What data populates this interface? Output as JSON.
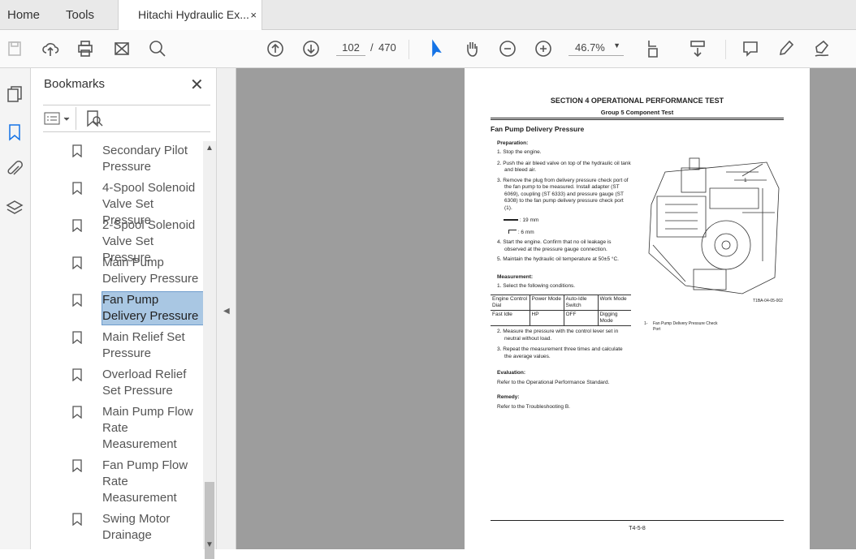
{
  "tabs": {
    "home": "Home",
    "tools": "Tools",
    "document": "Hitachi Hydraulic Ex...",
    "close": "×"
  },
  "toolbar": {
    "page_current": "102",
    "page_sep": "/",
    "page_total": "470",
    "zoom": "46.7%"
  },
  "bookmarks": {
    "title": "Bookmarks",
    "close": "✕",
    "items": [
      {
        "label": "Secondary Pilot Pressure"
      },
      {
        "label": "4-Spool Solenoid Valve Set Pressure"
      },
      {
        "label": "2-Spool Solenoid Valve Set Pressure"
      },
      {
        "label": "Main Pump Delivery Pressure"
      },
      {
        "label": "Fan Pump Delivery Pressure",
        "selected": true
      },
      {
        "label": "Main Relief Set Pressure"
      },
      {
        "label": "Overload Relief Set Pressure"
      },
      {
        "label": "Main Pump Flow Rate Measurement"
      },
      {
        "label": "Fan Pump Flow Rate Measurement"
      },
      {
        "label": "Swing Motor Drainage"
      }
    ]
  },
  "page": {
    "section": "SECTION 4 OPERATIONAL PERFORMANCE TEST",
    "group": "Group 5 Component Test",
    "heading": "Fan Pump Delivery Pressure",
    "prep_label": "Preparation:",
    "prep": [
      "1.  Stop the engine.",
      "2.  Push the air bleed valve on top of the hydraulic oil tank and bleed air.",
      "3.  Remove the plug from delivery pressure check port of the fan pump to be measured. Install adapter (ST 6069), coupling (ST 6333) and pressure gauge (ST 6308) to the fan pump delivery pressure check port (1).",
      "4.  Start the engine. Confirm that no oil leakage is observed at the pressure gauge connection.",
      "5.  Maintain the hydraulic oil temperature at 50±5 °C."
    ],
    "tool1": ": 19 mm",
    "tool2": ": 6 mm",
    "meas_label": "Measurement:",
    "meas1": "1.  Select the following conditions.",
    "table": {
      "headers": [
        "Engine Control Dial",
        "Power Mode",
        "Auto-Idle Switch",
        "Work Mode"
      ],
      "row": [
        "Fast Idle",
        "HP",
        "OFF",
        "Digging Mode"
      ]
    },
    "meas": [
      "2.  Measure the pressure with the control lever set in neutral without load.",
      "3.  Repeat the measurement three times and calculate the average values."
    ],
    "eval_label": "Evaluation:",
    "eval": "Refer to the Operational Performance Standard.",
    "remedy_label": "Remedy:",
    "remedy": "Refer to the Troubleshooting B.",
    "fig_code": "T1BA-04-05-002",
    "callout": "1",
    "legend_num": "1-",
    "legend": "Fan Pump Delivery Pressure Check Port",
    "footer": "T4-5-8"
  }
}
